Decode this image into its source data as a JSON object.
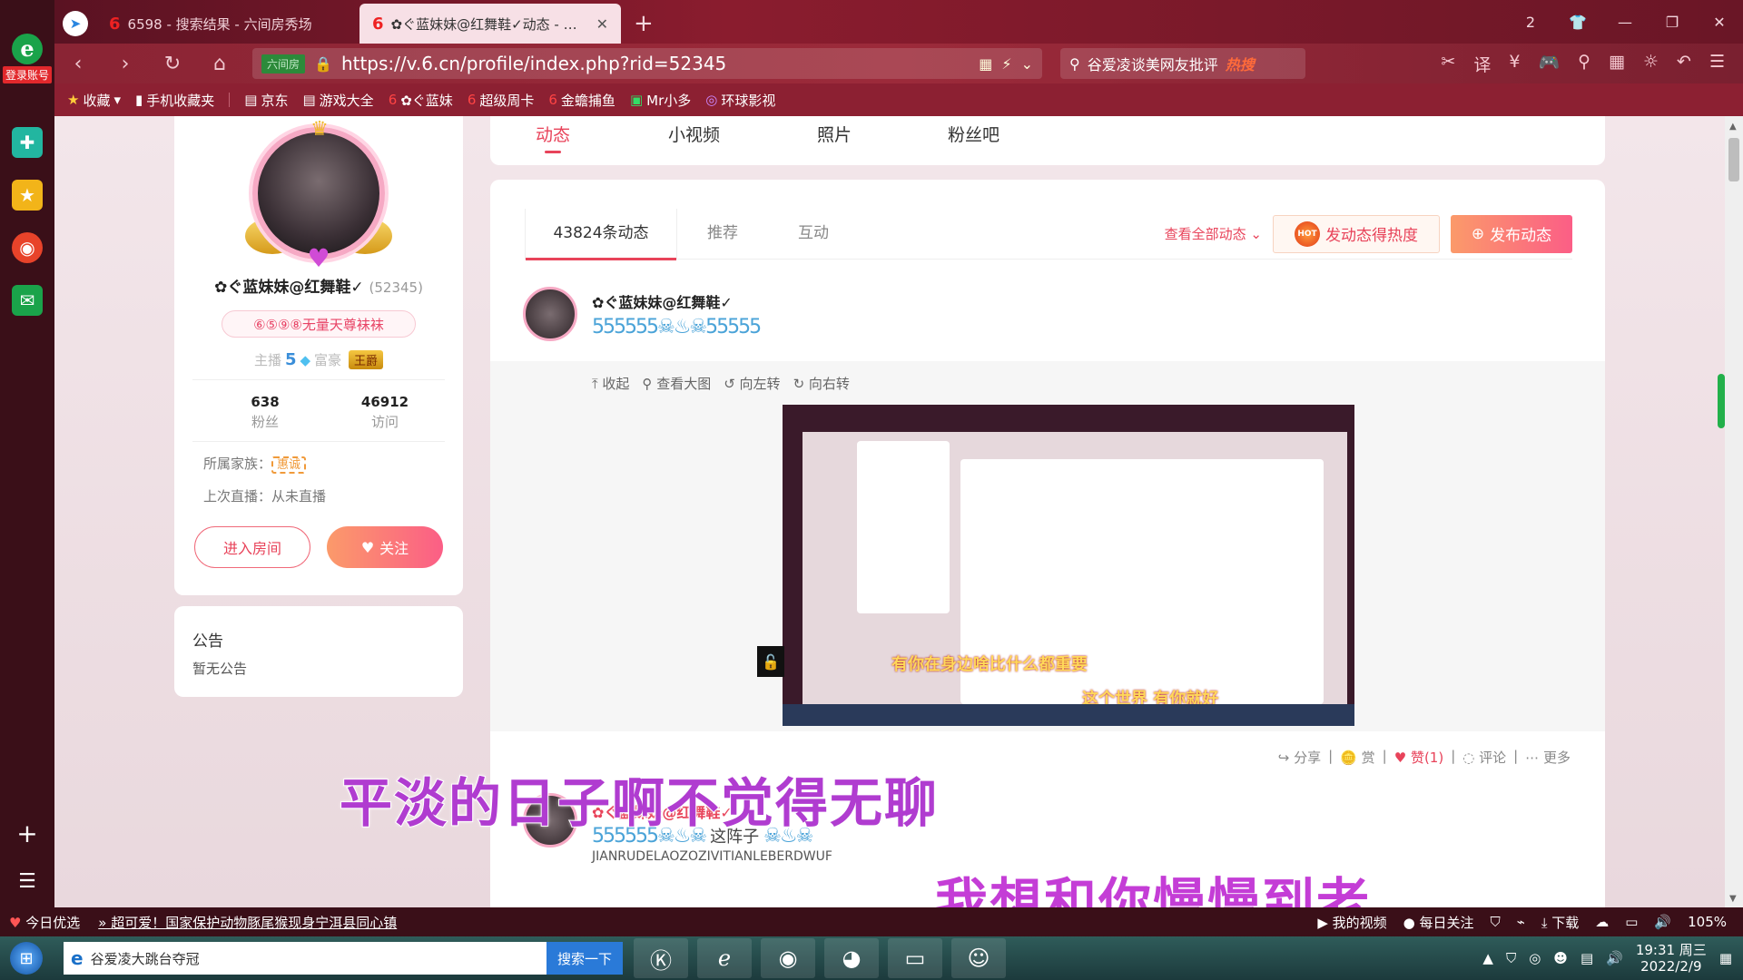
{
  "browser": {
    "logo": "e",
    "login_label": "登录账号",
    "tabs": [
      {
        "title": "6598 - 搜索结果 - 六间房秀场",
        "state": "inactive"
      },
      {
        "title": "✿ぐ蓝妹妹@红舞鞋✓动态 - 在线",
        "state": "active"
      }
    ],
    "new_tab": "+",
    "tab_count": "2",
    "url_site_label": "六间房",
    "url": "https://v.6.cn/profile/index.php?rid=52345",
    "search_text": "谷爱凌谈美网友批评",
    "search_hot": "热搜",
    "translate_label": "译",
    "bookmarks": [
      "收藏",
      "手机收藏夹",
      "京东",
      "游戏大全",
      "✿ぐ蓝妹",
      "超级周卡",
      "金蟾捕鱼",
      "Mr小多",
      "环球影视"
    ]
  },
  "profile": {
    "name": "✿ぐ蓝妹妹@红舞鞋✓",
    "rid": "(52345)",
    "badge": "⑥⑤⑨⑧无量天尊袜袜",
    "anchor_label": "主播",
    "anchor_level": "5",
    "rich_label": "富豪",
    "rich_title": "王爵",
    "fans_count": "638",
    "fans_label": "粉丝",
    "visits_count": "46912",
    "visits_label": "访问",
    "family_label": "所属家族：",
    "family_name": "惠诚",
    "last_live": "上次直播：从未直播",
    "enter_room": "进入房间",
    "follow": "关注"
  },
  "notice": {
    "title": "公告",
    "content": "暂无公告"
  },
  "nav": {
    "tabs": [
      "动态",
      "小视频",
      "照片",
      "粉丝吧"
    ],
    "active": 0
  },
  "feed": {
    "subtabs": [
      "43824条动态",
      "推荐",
      "互动"
    ],
    "view_all": "查看全部动态",
    "hot_button": "发动态得热度",
    "hot_badge": "HOT",
    "publish_button": "发布动态",
    "post1": {
      "author": "✿ぐ蓝妹妹@红舞鞋✓",
      "tools": [
        "收起",
        "查看大图",
        "向左转",
        "向右转"
      ],
      "inner_subtitle_1": "有你在身边啥比什么都重要",
      "inner_subtitle_2": "这个世界 有你就好",
      "actions": {
        "share": "分享",
        "reward": "赏",
        "like": "赞(1)",
        "comment": "评论",
        "more": "更多"
      }
    },
    "post2": {
      "author": "✿ぐ蓝妹妹@红舞鞋✓",
      "text": "这阵子",
      "desc": "JIANRUDELAOZOZIVITIANLEBERDWUF"
    }
  },
  "subtitles": {
    "line1": "平淡的日子啊不觉得无聊",
    "line2": "我想和你慢慢到老"
  },
  "statusbar": {
    "today": "今日优选",
    "news": "超可爱！国家保护动物豚尾猴现身宁洱县同心镇",
    "my_video": "我的视频",
    "daily": "每日关注",
    "download": "下载",
    "zoom": "105%"
  },
  "taskbar": {
    "search_text": "谷爱凌大跳台夺冠",
    "search_button": "搜索一下",
    "time": "19:31 周三",
    "date": "2022/2/9"
  },
  "colors": {
    "accent": "#e8435a",
    "browser_tab": "#8a1c2e",
    "taskbar": "#1c3a3c"
  }
}
